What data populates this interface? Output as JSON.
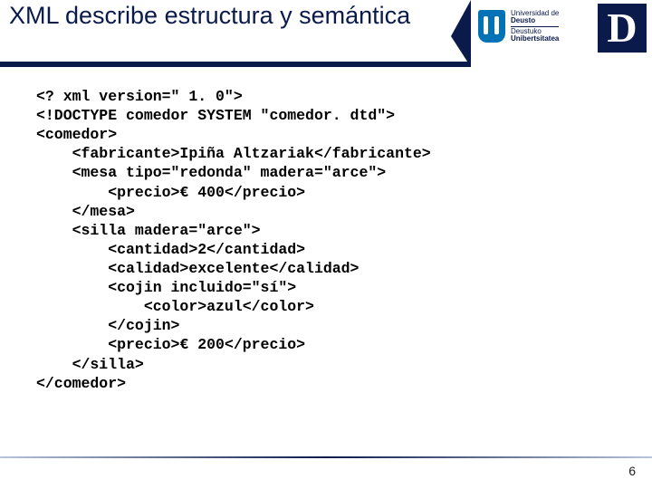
{
  "title": "XML describe estructura y semántica",
  "logo_top": "Universidad de",
  "logo_mid": "Deusto",
  "logo_bot1": "Deustuko",
  "logo_bot2": "Unibertsitatea",
  "logo_letter": "D",
  "code": "<? xml version=\" 1. 0\">\n<!DOCTYPE comedor SYSTEM \"comedor. dtd\">\n<comedor>\n    <fabricante>Ipiña Altzariak</fabricante>\n    <mesa tipo=\"redonda\" madera=\"arce\">\n        <precio>€ 400</precio>\n    </mesa>\n    <silla madera=\"arce\">\n        <cantidad>2</cantidad>\n        <calidad>excelente</calidad>\n        <cojin incluido=\"sí\">\n            <color>azul</color>\n        </cojin>\n        <precio>€ 200</precio>\n    </silla>\n</comedor>",
  "page_number": "6"
}
